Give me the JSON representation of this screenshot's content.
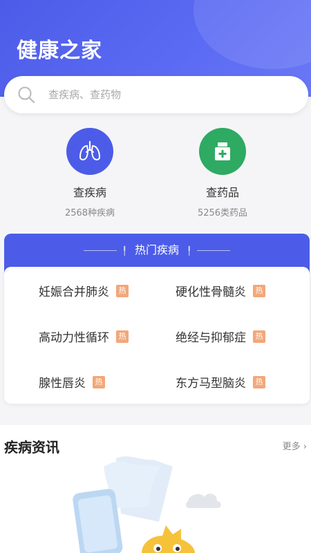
{
  "header": {
    "title": "健康之家"
  },
  "search": {
    "placeholder": "查疾病、查药物"
  },
  "entries": [
    {
      "label": "查疾病",
      "sub": "2568种疾病",
      "icon": "lungs-icon",
      "color": "#4c5ce8"
    },
    {
      "label": "查药品",
      "sub": "5256类药品",
      "icon": "medicine-box-icon",
      "color": "#2eaa63"
    }
  ],
  "hot": {
    "title": "热门疾病",
    "badge": "热",
    "items": [
      "妊娠合并肺炎",
      "硬化性骨髓炎",
      "高动力性循环",
      "绝经与抑郁症",
      "腺性唇炎",
      "东方马型脑炎"
    ]
  },
  "news": {
    "title": "疾病资讯",
    "more": "更多"
  },
  "colors": {
    "primary": "#4c5ce8",
    "green": "#2eaa63",
    "hot_badge": "#f2a77a"
  }
}
